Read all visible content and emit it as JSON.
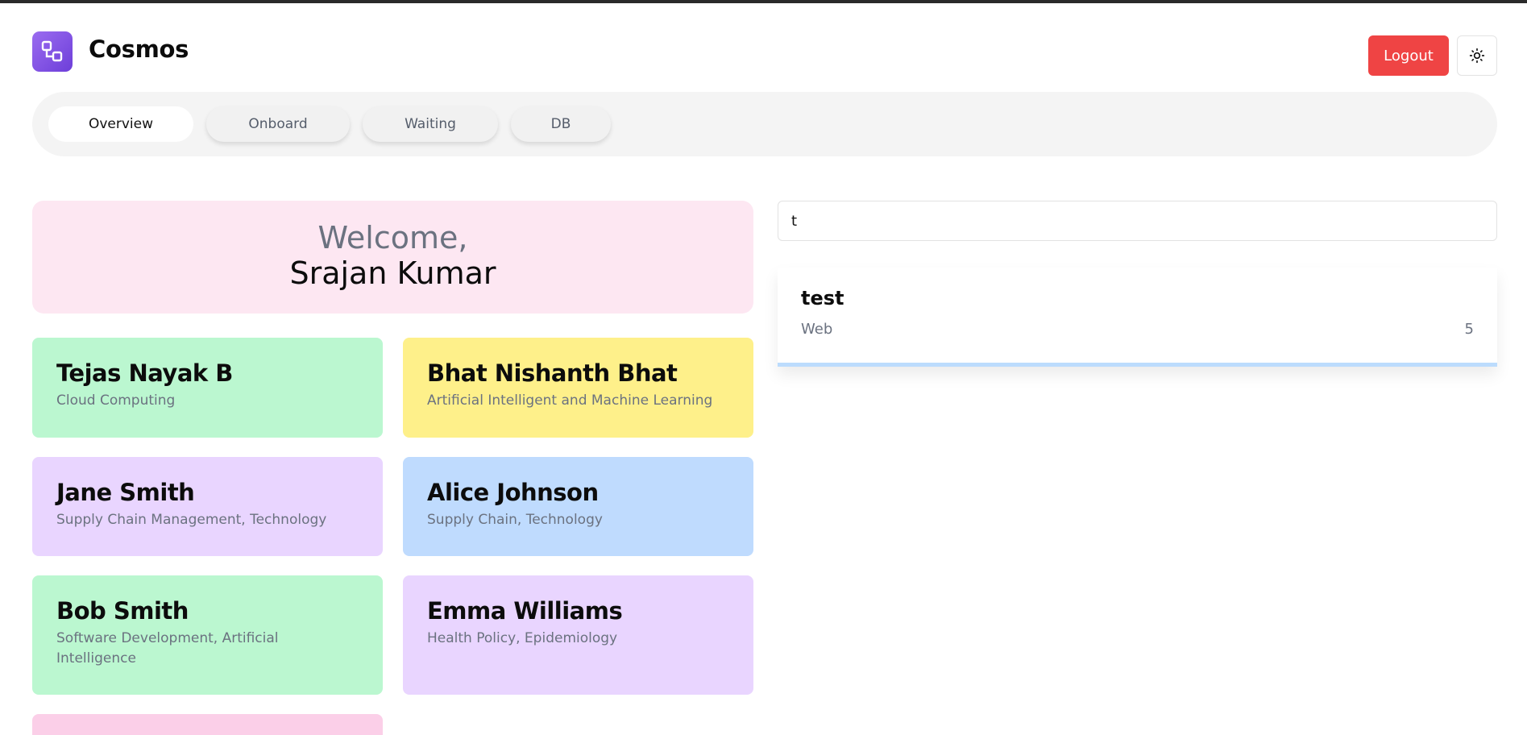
{
  "app": {
    "title": "Cosmos"
  },
  "header": {
    "logout_label": "Logout",
    "theme_icon": "sun-icon"
  },
  "tabs": [
    {
      "label": "Overview",
      "active": true
    },
    {
      "label": "Onboard",
      "active": false
    },
    {
      "label": "Waiting",
      "active": false
    },
    {
      "label": "DB",
      "active": false
    }
  ],
  "welcome": {
    "greeting": "Welcome,",
    "user_name": "Srajan Kumar"
  },
  "people": [
    {
      "name": "Tejas Nayak B",
      "field": "Cloud Computing",
      "color": "#bbf7d0"
    },
    {
      "name": "Bhat Nishanth Bhat",
      "field": "Artificial Intelligent and Machine Learning",
      "color": "#fef08a"
    },
    {
      "name": "Jane Smith",
      "field": "Supply Chain Management, Technology",
      "color": "#e9d5ff"
    },
    {
      "name": "Alice Johnson",
      "field": "Supply Chain, Technology",
      "color": "#bfdbfe"
    },
    {
      "name": "Bob Smith",
      "field": "Software Development, Artificial Intelligence",
      "color": "#bbf7d0"
    },
    {
      "name": "Emma Williams",
      "field": "Health Policy, Epidemiology",
      "color": "#e9d5ff"
    },
    {
      "name": "",
      "field": "",
      "color": "#fbcfe8"
    }
  ],
  "search": {
    "value": "t"
  },
  "results": [
    {
      "title": "test",
      "category": "Web",
      "count": "5"
    }
  ],
  "colors": {
    "accent": "#7c4ddf",
    "logout": "#ef4444",
    "result_border": "#bcdcfd"
  }
}
